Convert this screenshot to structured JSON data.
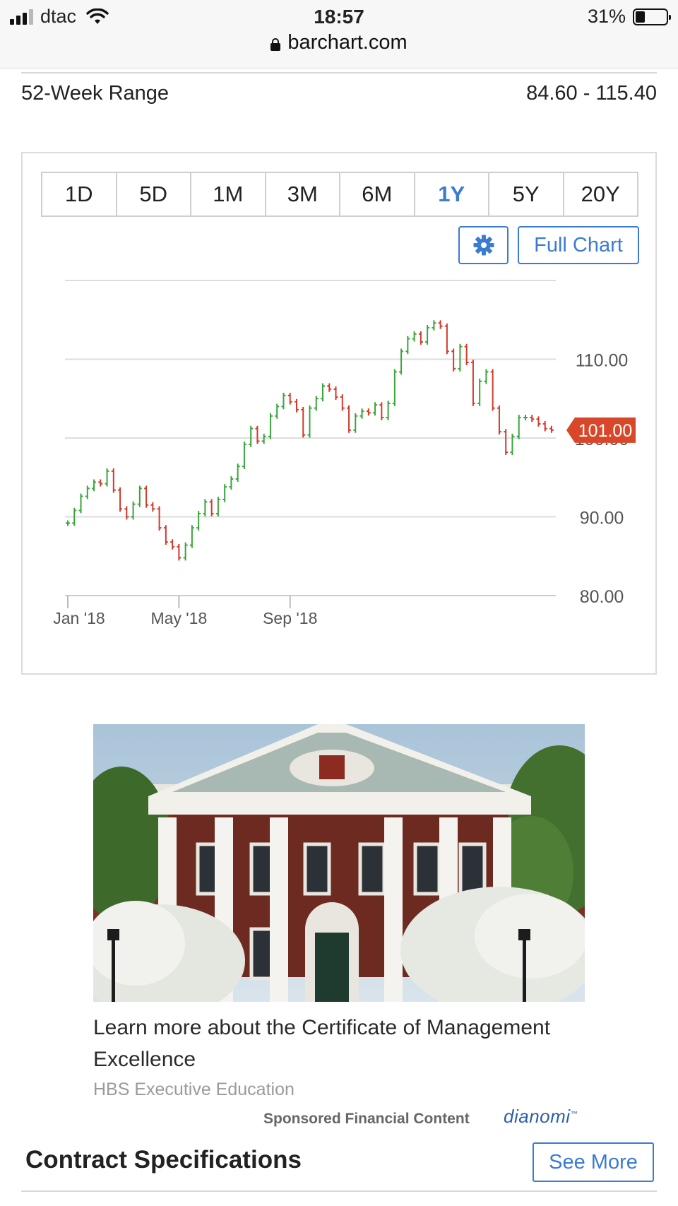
{
  "status_bar": {
    "carrier": "dtac",
    "time": "18:57",
    "battery_percent": "31%",
    "battery_level": 0.31,
    "signal_bars": 3,
    "signal_total": 4,
    "url": "barchart.com"
  },
  "stats": {
    "label": "52-Week Range",
    "value": "84.60 - 115.40"
  },
  "chart_controls": {
    "tabs": [
      "1D",
      "5D",
      "1M",
      "3M",
      "6M",
      "1Y",
      "5Y",
      "20Y"
    ],
    "active_tab": "1Y",
    "full_chart_label": "Full Chart",
    "settings_icon": "gear-icon"
  },
  "chart_data": {
    "type": "line",
    "style": "ohlc-bars",
    "x_tick_labels": [
      "Jan '18",
      "May '18",
      "Sep '18"
    ],
    "x_tick_weeks": [
      0,
      17,
      34
    ],
    "y_ticks": [
      80,
      90,
      100,
      110,
      120
    ],
    "y_tick_labels": [
      "80.00",
      "90.00",
      "100.00",
      "110.00"
    ],
    "ylim": [
      80,
      120
    ],
    "last_price": 101.0,
    "last_price_label": "101.00",
    "colors": {
      "up": "#3aa53a",
      "down": "#d23b2a",
      "label_bg": "#d9472b",
      "grid": "#dddddd"
    },
    "series": [
      {
        "values": [
          89.2,
          90.8,
          92.6,
          93.6,
          94.4,
          94.2,
          95.8,
          93.4,
          91.0,
          90.0,
          91.6,
          93.6,
          91.5,
          91.0,
          88.6,
          86.8,
          86.2,
          84.8,
          86.4,
          88.6,
          90.4,
          91.9,
          90.4,
          92.2,
          93.8,
          94.8,
          96.4,
          99.2,
          101.2,
          99.6,
          100.2,
          102.8,
          104.0,
          105.4,
          104.6,
          103.6,
          100.4,
          103.8,
          105.0,
          106.6,
          106.2,
          105.2,
          103.8,
          101.0,
          102.8,
          103.4,
          103.2,
          104.2,
          102.6,
          104.4,
          108.4,
          111.0,
          112.6,
          113.2,
          112.2,
          114.0,
          114.6,
          114.2,
          111.0,
          108.8,
          111.6,
          109.6,
          104.4,
          107.2,
          108.4,
          103.8,
          100.8,
          98.2,
          100.2,
          102.6,
          102.6,
          102.4,
          101.8,
          101.2,
          101.0
        ]
      }
    ]
  },
  "ad": {
    "image_icon": "building-photo",
    "title": "Learn more about the Certificate of Management Excellence",
    "source": "HBS Executive Education",
    "sponsored_label": "Sponsored Financial Content",
    "network_logo": "dianomi"
  },
  "contract_specs": {
    "title": "Contract Specifications",
    "see_more_label": "See More"
  }
}
